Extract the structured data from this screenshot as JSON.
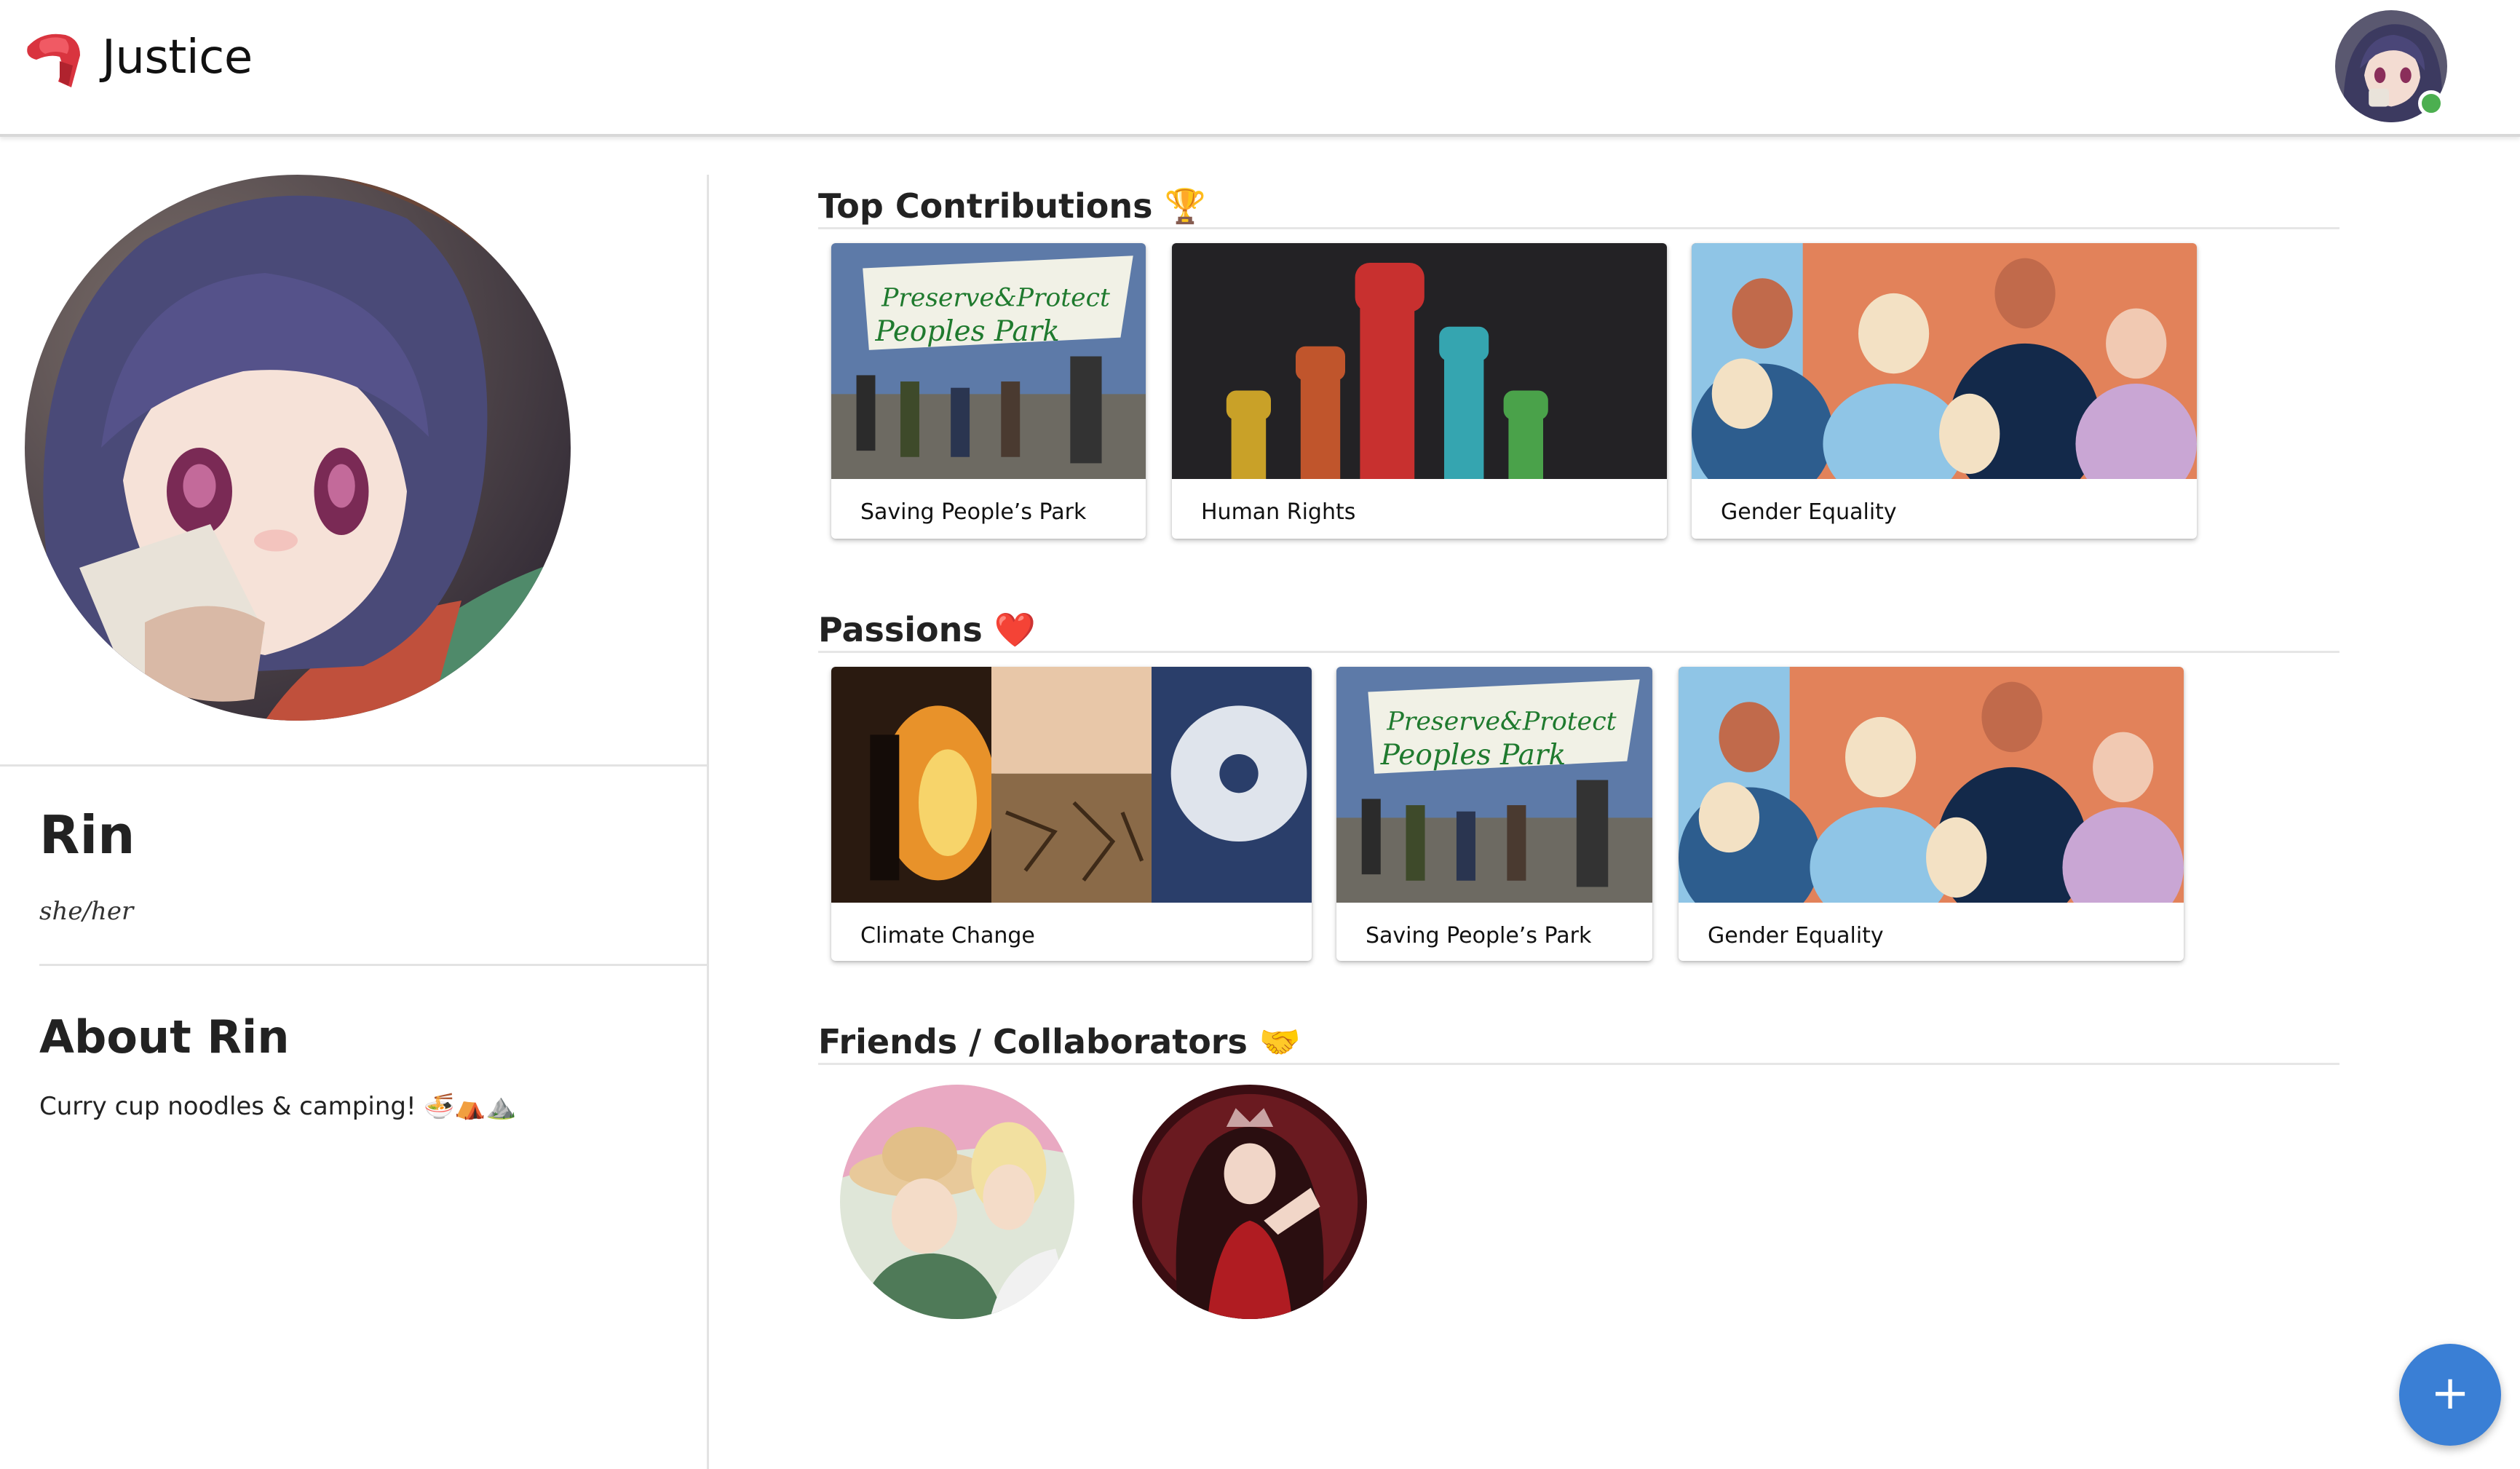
{
  "app": {
    "title": "Justice"
  },
  "profile": {
    "name": "Rin",
    "pronouns": "she/her",
    "about_title": "About Rin",
    "about_text": "Curry cup noodles & camping! 🍜⛺⛰️"
  },
  "sections": {
    "top_contributions": {
      "title": "Top Contributions 🏆",
      "cards": [
        {
          "label": "Saving People’s Park"
        },
        {
          "label": "Human Rights"
        },
        {
          "label": "Gender Equality"
        }
      ]
    },
    "passions": {
      "title": "Passions ❤️",
      "cards": [
        {
          "label": "Climate Change"
        },
        {
          "label": "Saving People’s Park"
        },
        {
          "label": "Gender Equality"
        }
      ]
    },
    "friends": {
      "title": "Friends / Collaborators 🤝"
    }
  },
  "fab": {
    "label": "+"
  },
  "colors": {
    "accent": "#3a7fd5",
    "online": "#4caf50"
  }
}
